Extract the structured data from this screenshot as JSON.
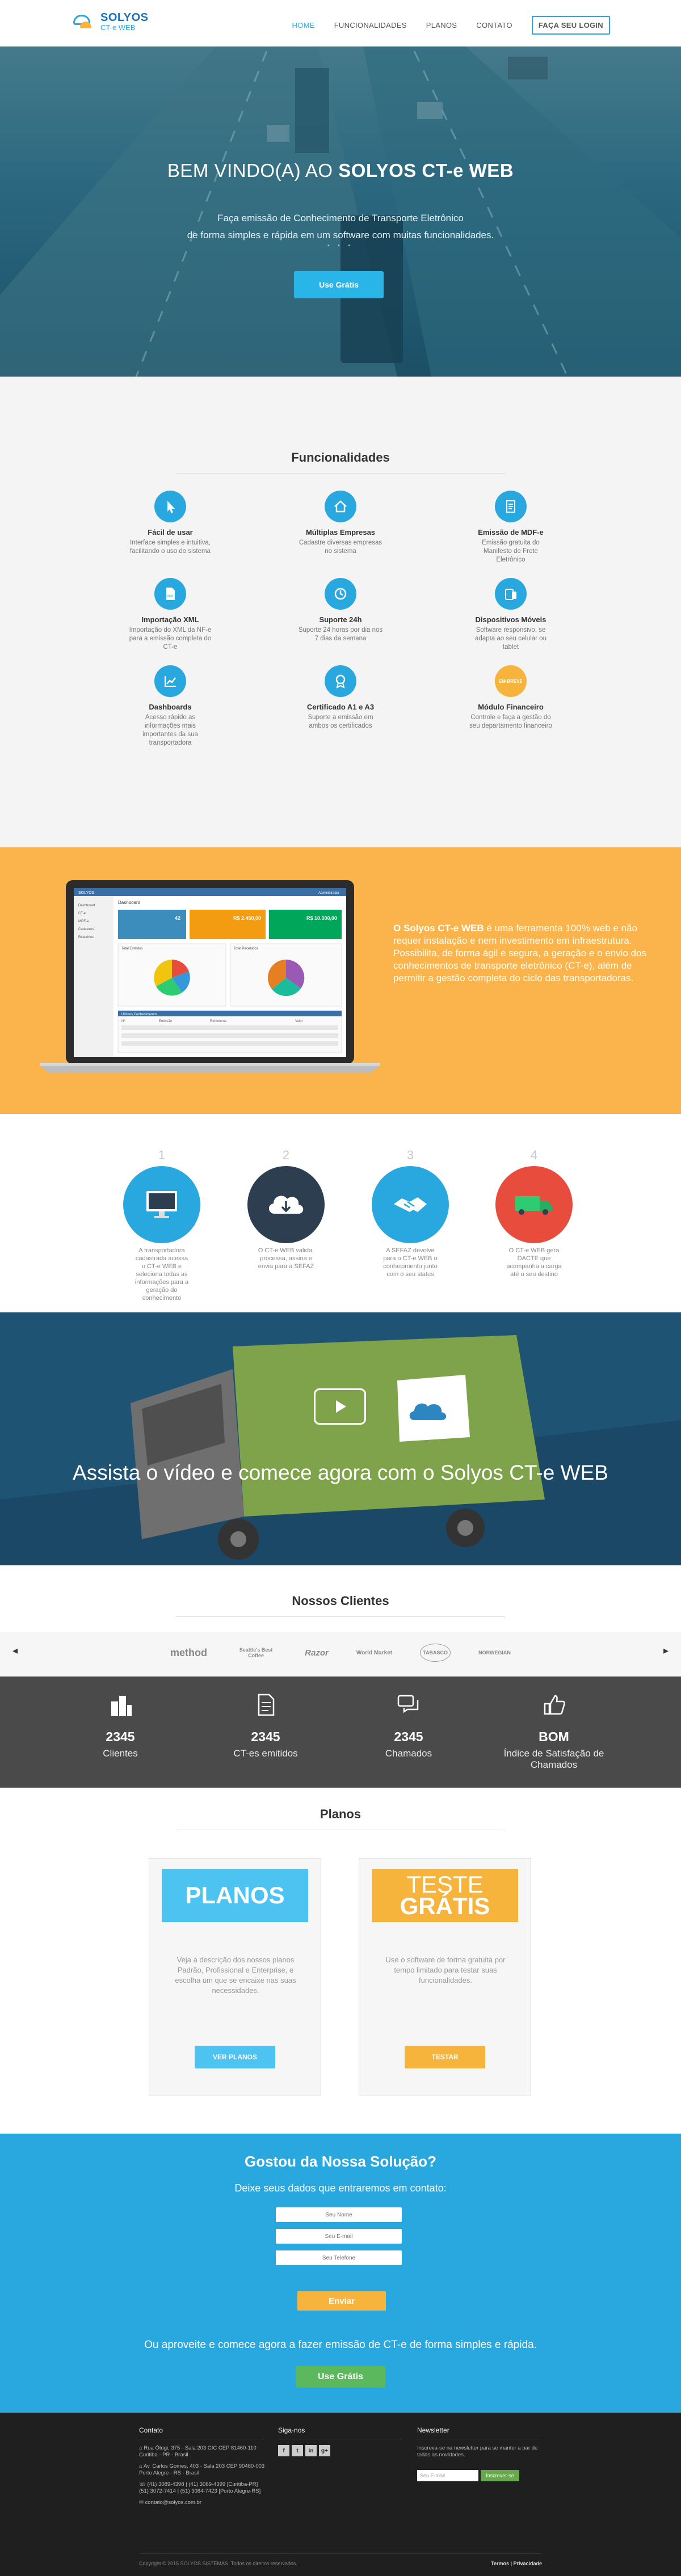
{
  "nav": {
    "logo_top": "SOLYOS",
    "logo_bottom": "CT-e WEB",
    "items": [
      "HOME",
      "FUNCIONALIDADES",
      "PLANOS",
      "CONTATO"
    ],
    "login": "FAÇA SEU LOGIN"
  },
  "hero": {
    "title_pre": "BEM VINDO(A) AO ",
    "title_bold": "SOLYOS CT-e WEB",
    "sub1": "Faça emissão de Conhecimento de Transporte Eletrônico",
    "sub2": "de forma simples e rápida em um software com muitas funcionalidades.",
    "dots": "• • •",
    "button": "Use Grátis"
  },
  "features": {
    "title": "Funcionalidades",
    "items": [
      {
        "title": "Fácil de usar",
        "desc": "Interface simples e intuitiva, facilitando o uso do sistema"
      },
      {
        "title": "Múltiplas Empresas",
        "desc": "Cadastre diversas empresas no sistema"
      },
      {
        "title": "Emissão de MDF-e",
        "desc": "Emissão gratuita do Manifesto de Frete Eletrônico"
      },
      {
        "title": "Importação XML",
        "desc": "Importação do XML da NF-e para a emissão completa do CT-e"
      },
      {
        "title": "Suporte 24h",
        "desc": "Suporte 24 horas por dia nos 7 dias da semana"
      },
      {
        "title": "Dispositivos Móveis",
        "desc": "Software responsivo, se adapta ao seu celular ou tablet"
      },
      {
        "title": "Dashboards",
        "desc": "Acesso rápido as informações mais importantes da sua transportadora"
      },
      {
        "title": "Certificado A1 e A3",
        "desc": "Suporte a emissão em ambos os certificados"
      },
      {
        "title": "Módulo Financeiro",
        "desc": "Controle e faça a gestão do seu departamento financeiro"
      }
    ],
    "badge": "EM BREVE"
  },
  "about": {
    "bold": "O Solyos CT-e WEB",
    "text1": " é uma ferramenta 100% web e não requer instalação e nem investimento em infraestrutura.",
    "text2": "Possibilita, de forma ágil e segura, a geração e o envio dos conhecimentos de transporte eletrônico (CT-e), além de permitir a gestão completa do ciclo das transportadoras."
  },
  "laptop": {
    "brand": "SOLYOS",
    "user": "Administrador",
    "dashboard": "Dashboard",
    "cards": [
      "42",
      "R$ 2.450,00",
      "R$ 10.000,00"
    ],
    "chart1": "Total Emitidos",
    "chart2": "Total Recebidos",
    "table": "Últimos Conhecimentos",
    "cols": [
      "Nº",
      "Emissão",
      "Remetente",
      "Valor"
    ],
    "menu": [
      "Dashboard",
      "CT-e",
      "MDF-e",
      "Cadastros",
      "Relatórios"
    ]
  },
  "steps": [
    {
      "num": "1",
      "desc": "A transportadora cadastrada acessa o CT-e WEB e seleciona todas as informações para a geração do conhecimento"
    },
    {
      "num": "2",
      "desc": "O CT-e WEB valida, processa, assina e envia para a SEFAZ"
    },
    {
      "num": "3",
      "desc": "A SEFAZ devolve para o CT-e WEB o conhecimento junto com o seu status"
    },
    {
      "num": "4",
      "desc": "O CT-e WEB gera DACTE que acompanha a carga até o seu destino"
    }
  ],
  "video": {
    "title": "Assista o vídeo e comece agora com o Solyos CT-e WEB"
  },
  "clients": {
    "title": "Nossos Clientes",
    "logos": [
      "method",
      "Seattle's Best Coffee",
      "Razor",
      "World Market",
      "TABASCO",
      "NORWEGIAN"
    ]
  },
  "stats": [
    {
      "value": "2345",
      "label": "Clientes"
    },
    {
      "value": "2345",
      "label": "CT-es emitidos"
    },
    {
      "value": "2345",
      "label": "Chamados"
    },
    {
      "value": "BOM",
      "label": "Índice de Satisfação de Chamados"
    }
  ],
  "plans": {
    "title": "Planos",
    "card1": {
      "head": "PLANOS",
      "desc": "Veja a descrição dos nossos planos Padrão, Profissional e Enterprise, e escolha um que se encaixe nas suas necessidades.",
      "button": "VER PLANOS"
    },
    "card2": {
      "head1": "TESTE",
      "head2": "GRÁTIS",
      "desc": "Use o software de forma gratuita por tempo limitado para testar suas funcionalidades.",
      "button": "TESTAR"
    }
  },
  "contact": {
    "title": "Gostou da Nossa Solução?",
    "sub": "Deixe seus dados que entraremos em contato:",
    "placeholders": {
      "name": "Seu Nome",
      "email": "Seu E-mail",
      "phone": "Seu Telefone"
    },
    "send": "Enviar",
    "cta": "Ou aproveite e comece agora a fazer emissão de CT-e de forma simples e rápida.",
    "try": "Use Grátis"
  },
  "footer": {
    "contact_title": "Contato",
    "address1": "Rua Ótugi, 375 - Sala 203 CIC CEP 81460-110",
    "address1b": "Curitiba - PR - Brasil",
    "address2": "Av. Carlos Gomes, 403 - Sala 203 CEP 90480-003",
    "address2b": "Porto Alegre - RS - Brasil",
    "phone1": "(41) 3089-4398 | (41) 3089-4399 [Curitiba-PR]",
    "phone2": "(51) 3072-7414 | (51) 3084-7423 [Porto Alegre-RS]",
    "email": "contato@solyos.com.br",
    "social_title": "Siga-nos",
    "social": [
      "f",
      "t",
      "in",
      "g+"
    ],
    "news_title": "Newsletter",
    "news_text": "Inscreva-se na newsletter para se manter a par de todas as novidades.",
    "news_placeholder": "Seu E-mail",
    "news_button": "Inscrever-se",
    "copyright": "Copyright © 2015 SOLYOS SISTEMAS. Todos os direitos reservados.",
    "links": "Termos  |  Privacidade"
  }
}
